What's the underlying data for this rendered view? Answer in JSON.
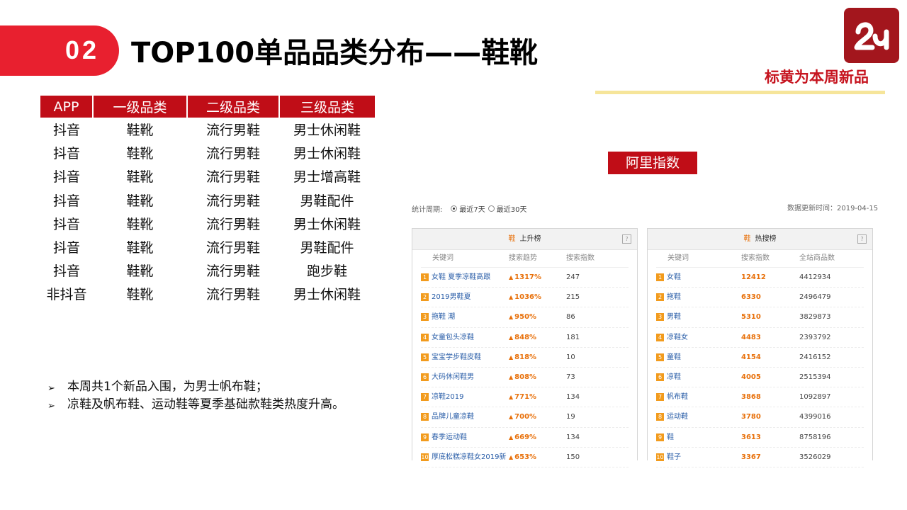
{
  "header": {
    "section_number": "02",
    "title": "TOP100单品品类分布——鞋靴",
    "note": "标黄为本周新品"
  },
  "category_table": {
    "columns": [
      "APP",
      "一级品类",
      "二级品类",
      "三级品类"
    ],
    "rows": [
      [
        "抖音",
        "鞋靴",
        "流行男鞋",
        "男士休闲鞋"
      ],
      [
        "抖音",
        "鞋靴",
        "流行男鞋",
        "男士休闲鞋"
      ],
      [
        "抖音",
        "鞋靴",
        "流行男鞋",
        "男士增高鞋"
      ],
      [
        "抖音",
        "鞋靴",
        "流行男鞋",
        "男鞋配件"
      ],
      [
        "抖音",
        "鞋靴",
        "流行男鞋",
        "男士休闲鞋"
      ],
      [
        "抖音",
        "鞋靴",
        "流行男鞋",
        "男鞋配件"
      ],
      [
        "抖音",
        "鞋靴",
        "流行男鞋",
        "跑步鞋"
      ],
      [
        "非抖音",
        "鞋靴",
        "流行男鞋",
        "男士休闲鞋"
      ]
    ]
  },
  "bullets": [
    "本周共1个新品入围，为男士帆布鞋；",
    "凉鞋及帆布鞋、运动鞋等夏季基础款鞋类热度升高。"
  ],
  "ali": {
    "label": "阿里指数",
    "period_label": "统计周期:",
    "option_7": "最近7天",
    "option_30": "最近30天",
    "update_text": "数据更新时间：2019-04-15",
    "rising": {
      "tag": "鞋",
      "title": "上升榜",
      "columns": [
        "关键词",
        "搜索趋势",
        "搜索指数"
      ],
      "rows": [
        {
          "rank": "1",
          "keyword": "女鞋 夏季凉鞋高跟",
          "trend": "1317%",
          "index": "247"
        },
        {
          "rank": "2",
          "keyword": "2019男鞋夏",
          "trend": "1036%",
          "index": "215"
        },
        {
          "rank": "3",
          "keyword": "拖鞋 潮",
          "trend": "950%",
          "index": "86"
        },
        {
          "rank": "4",
          "keyword": "女童包头凉鞋",
          "trend": "848%",
          "index": "181"
        },
        {
          "rank": "5",
          "keyword": "宝宝学步鞋皮鞋",
          "trend": "818%",
          "index": "10"
        },
        {
          "rank": "6",
          "keyword": "大码休闲鞋男",
          "trend": "808%",
          "index": "73"
        },
        {
          "rank": "7",
          "keyword": "凉鞋2019",
          "trend": "771%",
          "index": "134"
        },
        {
          "rank": "8",
          "keyword": "品牌儿童凉鞋",
          "trend": "700%",
          "index": "19"
        },
        {
          "rank": "9",
          "keyword": "春季运动鞋",
          "trend": "669%",
          "index": "134"
        },
        {
          "rank": "10",
          "keyword": "厚底松糕凉鞋女2019新",
          "trend": "653%",
          "index": "150"
        }
      ]
    },
    "hot": {
      "tag": "鞋",
      "title": "热搜榜",
      "columns": [
        "关键词",
        "搜索指数",
        "全站商品数"
      ],
      "rows": [
        {
          "rank": "1",
          "keyword": "女鞋",
          "index": "12412",
          "total": "4412934"
        },
        {
          "rank": "2",
          "keyword": "拖鞋",
          "index": "6330",
          "total": "2496479"
        },
        {
          "rank": "3",
          "keyword": "男鞋",
          "index": "5310",
          "total": "3829873"
        },
        {
          "rank": "4",
          "keyword": "凉鞋女",
          "index": "4483",
          "total": "2393792"
        },
        {
          "rank": "5",
          "keyword": "童鞋",
          "index": "4154",
          "total": "2416152"
        },
        {
          "rank": "6",
          "keyword": "凉鞋",
          "index": "4005",
          "total": "2515394"
        },
        {
          "rank": "7",
          "keyword": "帆布鞋",
          "index": "3868",
          "total": "1092897"
        },
        {
          "rank": "8",
          "keyword": "运动鞋",
          "index": "3780",
          "total": "4399016"
        },
        {
          "rank": "9",
          "keyword": "鞋",
          "index": "3613",
          "total": "8758196"
        },
        {
          "rank": "10",
          "keyword": "鞋子",
          "index": "3367",
          "total": "3526029"
        }
      ]
    }
  }
}
